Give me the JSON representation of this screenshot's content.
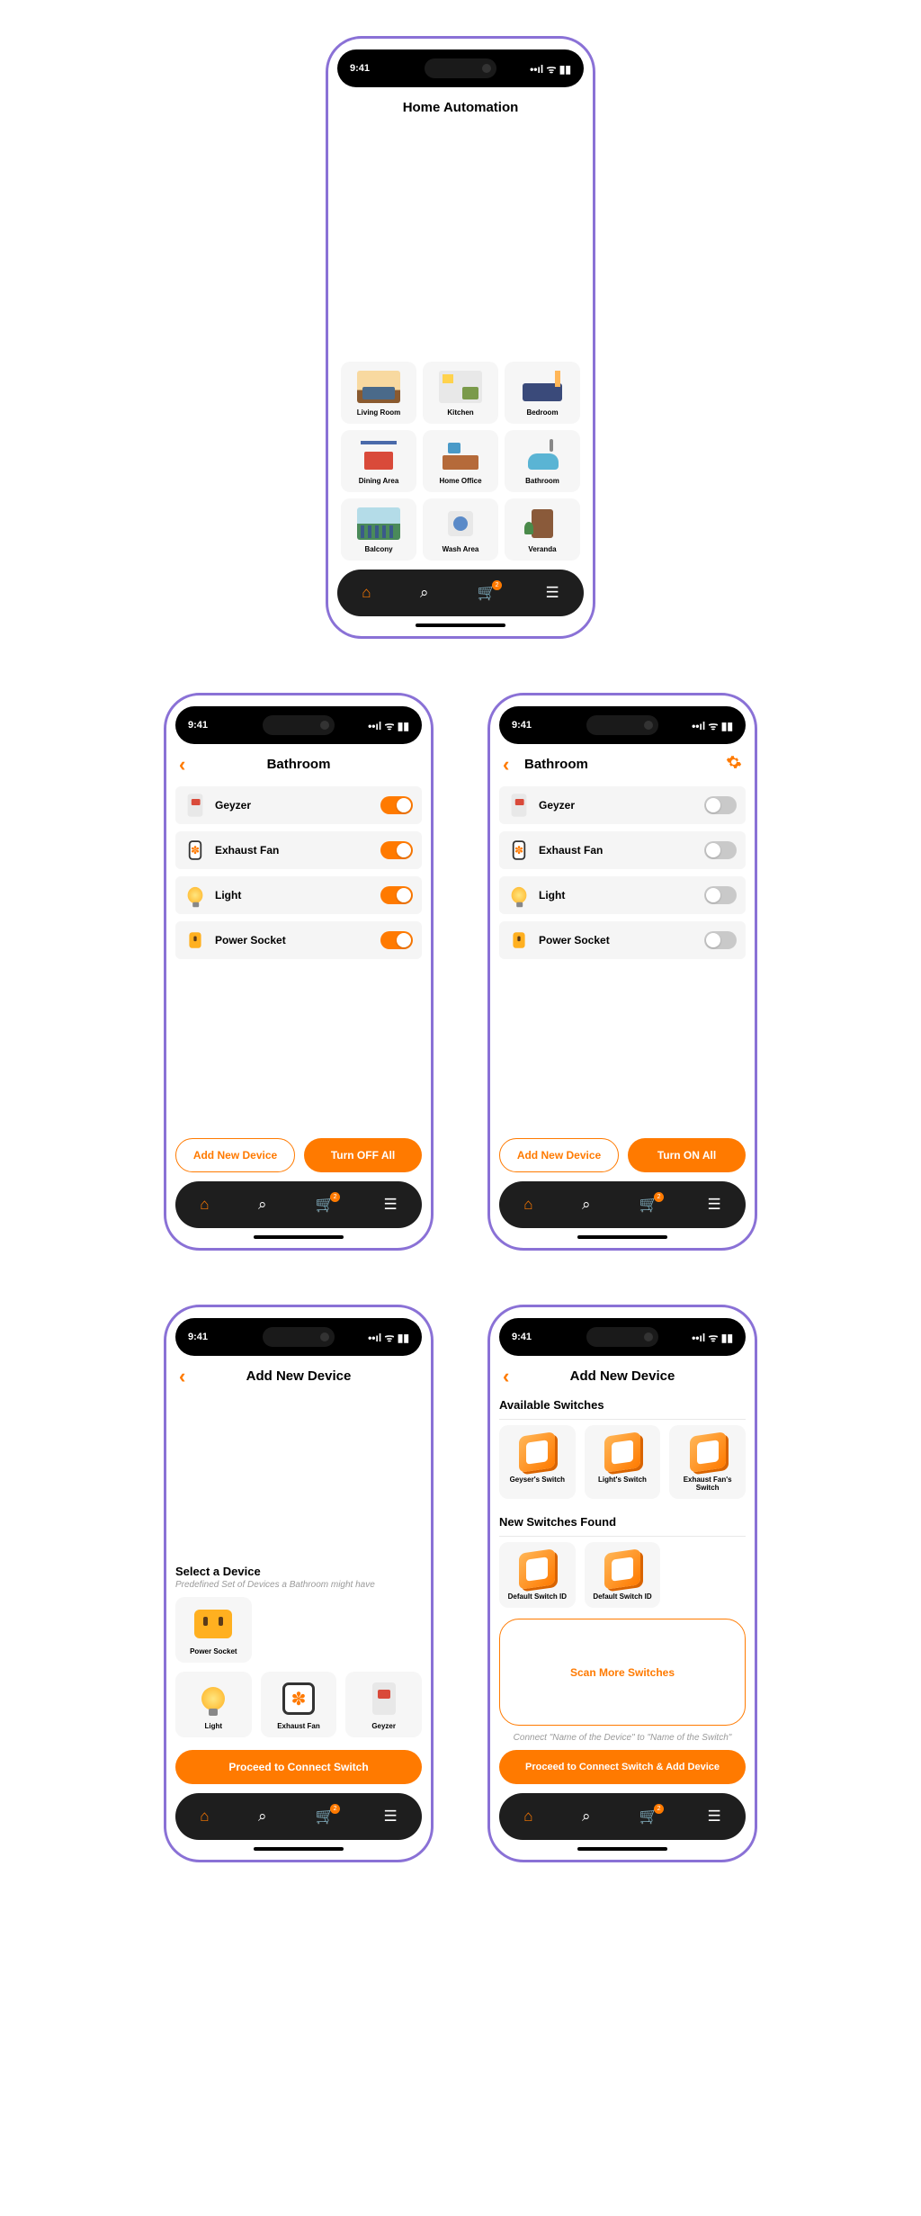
{
  "statusTime": "9:41",
  "screens": {
    "home": {
      "title": "Home Automation",
      "rooms": [
        {
          "label": "Living Room",
          "cls": "living"
        },
        {
          "label": "Kitchen",
          "cls": "kitchen"
        },
        {
          "label": "Bedroom",
          "cls": "bedroom"
        },
        {
          "label": "Dining Area",
          "cls": "dining"
        },
        {
          "label": "Home Office",
          "cls": "office"
        },
        {
          "label": "Bathroom",
          "cls": "bath"
        },
        {
          "label": "Balcony",
          "cls": "balcony"
        },
        {
          "label": "Wash Area",
          "cls": "wash"
        },
        {
          "label": "Veranda",
          "cls": "veranda"
        }
      ]
    },
    "roomOn": {
      "title": "Bathroom",
      "devices": [
        {
          "name": "Geyzer"
        },
        {
          "name": "Exhaust Fan"
        },
        {
          "name": "Light"
        },
        {
          "name": "Power Socket"
        }
      ],
      "addBtn": "Add New Device",
      "toggleAllBtn": "Turn OFF All"
    },
    "roomOff": {
      "title": "Bathroom",
      "devices": [
        {
          "name": "Geyzer"
        },
        {
          "name": "Exhaust Fan"
        },
        {
          "name": "Light"
        },
        {
          "name": "Power Socket"
        }
      ],
      "addBtn": "Add New Device",
      "toggleAllBtn": "Turn ON All"
    },
    "addDevice": {
      "title": "Add New Device",
      "sectTitle": "Select a Device",
      "sectSub": "Predefined Set of Devices a Bathroom might have",
      "tilesTop": [
        {
          "label": "Power Socket"
        }
      ],
      "tilesBottom": [
        {
          "label": "Light"
        },
        {
          "label": "Exhaust Fan"
        },
        {
          "label": "Geyzer"
        }
      ],
      "proceedBtn": "Proceed to Connect Switch"
    },
    "connectSwitch": {
      "title": "Add New Device",
      "availTitle": "Available Switches",
      "availSwitches": [
        {
          "label": "Geyser's Switch"
        },
        {
          "label": "Light's Switch"
        },
        {
          "label": "Exhaust Fan's Switch"
        }
      ],
      "newTitle": "New Switches Found",
      "newSwitches": [
        {
          "label": "Default Switch ID"
        },
        {
          "label": "Default Switch ID"
        }
      ],
      "scanBtn": "Scan More Switches",
      "hint": "Connect \"Name of the Device\" to \"Name of the Switch\"",
      "proceedBtn": "Proceed to Connect Switch & Add Device"
    }
  },
  "cartBadge": "2"
}
